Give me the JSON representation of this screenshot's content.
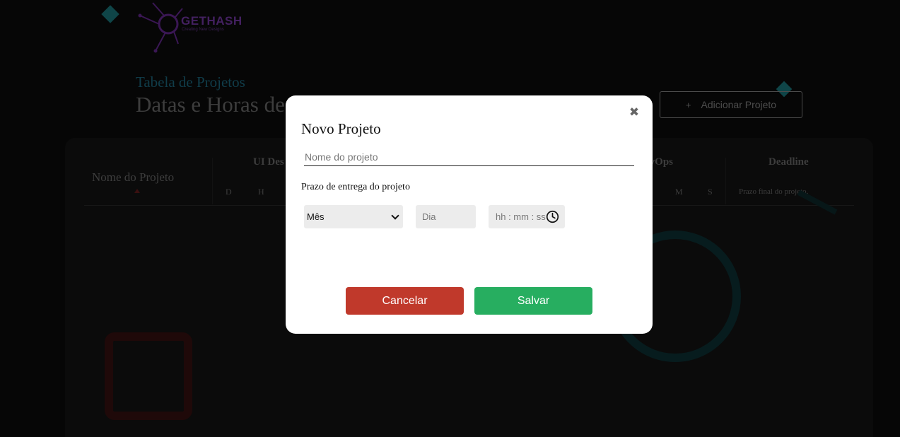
{
  "brand": {
    "name": "GETHASH",
    "tagline": "Creating New Designs",
    "logo_icon": "circuit-logo-icon",
    "logo_color": "#7a3bb0"
  },
  "header": {
    "subtitle": "Tabela de Projetos",
    "title": "Datas e Horas de",
    "add_button_icon": "+",
    "add_button_label": "Adicionar Projeto"
  },
  "table": {
    "name_header": "Nome do Projeto",
    "group_ui": "UI Des",
    "group_devops": "evOps",
    "deadline_header": "Deadline",
    "deadline_sub": "Prazo final do projeto.",
    "ui_sub": [
      "D",
      "H"
    ],
    "devops_sub": [
      "M",
      "S"
    ]
  },
  "modal": {
    "title": "Novo Projeto",
    "close_icon": "close-icon",
    "name_placeholder": "Nome do projeto",
    "deadline_label": "Prazo de entrega do projeto",
    "month_selected": "Mês",
    "day_placeholder": "Dia",
    "time_placeholder": "hh : mm : ss",
    "cancel_label": "Cancelar",
    "save_label": "Salvar"
  },
  "colors": {
    "background": "#0b0b0b",
    "accent_teal": "#1d7f83",
    "cancel_red": "#c0392b",
    "save_green": "#27ae60"
  }
}
